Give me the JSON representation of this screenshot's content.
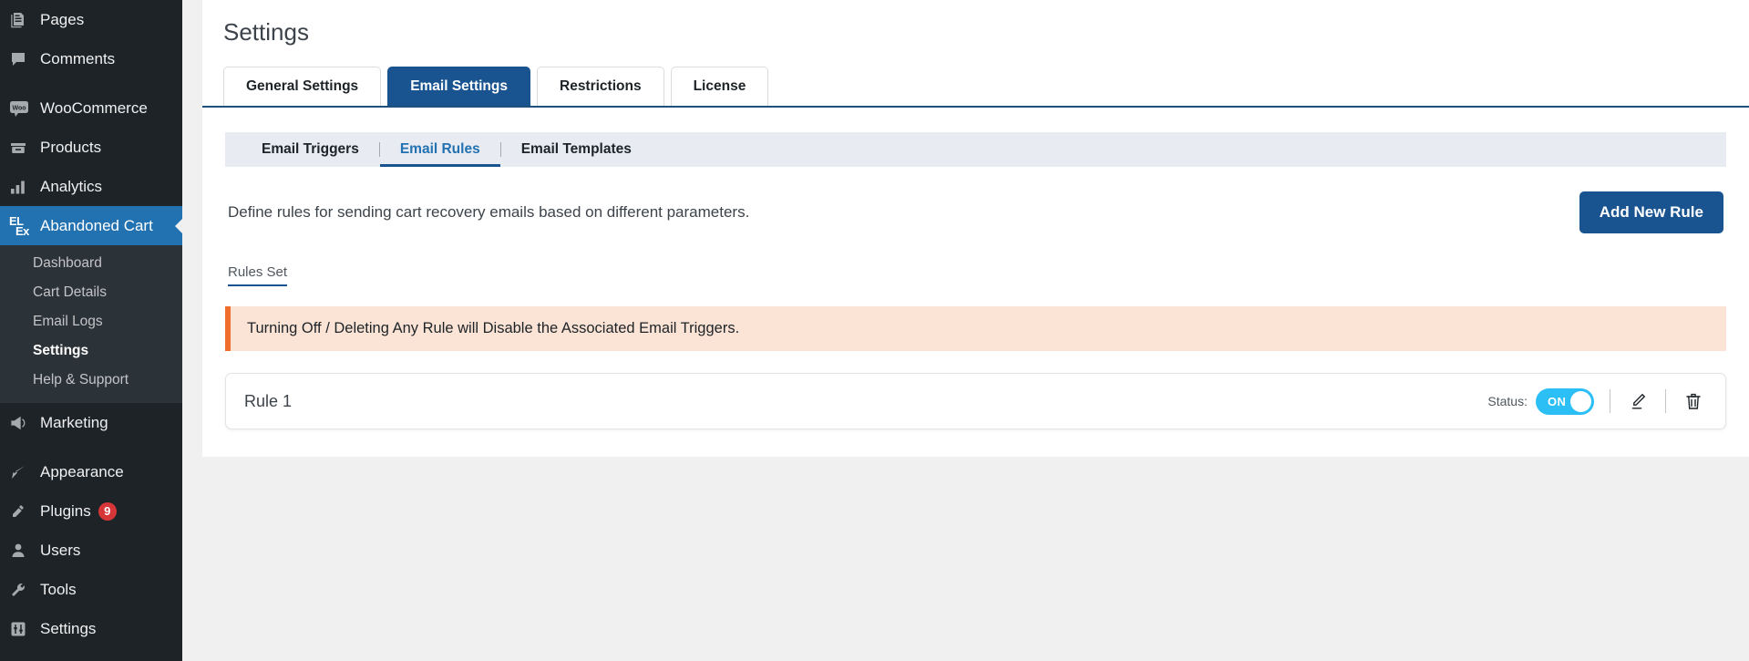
{
  "sidebar": {
    "items": [
      {
        "label": "Pages",
        "icon": "pages-icon",
        "active": false
      },
      {
        "label": "Comments",
        "icon": "comments-icon",
        "active": false
      },
      {
        "label": "WooCommerce",
        "icon": "woocommerce-icon",
        "active": false
      },
      {
        "label": "Products",
        "icon": "products-icon",
        "active": false
      },
      {
        "label": "Analytics",
        "icon": "analytics-icon",
        "active": false
      },
      {
        "label": "Abandoned Cart",
        "icon": "elex-icon",
        "active": true
      },
      {
        "label": "Marketing",
        "icon": "megaphone-icon",
        "active": false
      },
      {
        "label": "Appearance",
        "icon": "paintbrush-icon",
        "active": false
      },
      {
        "label": "Plugins",
        "icon": "plug-icon",
        "active": false,
        "badge": "9"
      },
      {
        "label": "Users",
        "icon": "user-icon",
        "active": false
      },
      {
        "label": "Tools",
        "icon": "wrench-icon",
        "active": false
      },
      {
        "label": "Settings",
        "icon": "settings-sliders-icon",
        "active": false
      }
    ],
    "submenu": [
      {
        "label": "Dashboard",
        "current": false
      },
      {
        "label": "Cart Details",
        "current": false
      },
      {
        "label": "Email Logs",
        "current": false
      },
      {
        "label": "Settings",
        "current": true
      },
      {
        "label": "Help & Support",
        "current": false
      }
    ],
    "elex_icon_top": "EL",
    "elex_icon_bottom": "Ex"
  },
  "page": {
    "title": "Settings"
  },
  "tabs": [
    {
      "label": "General Settings",
      "active": false
    },
    {
      "label": "Email Settings",
      "active": true
    },
    {
      "label": "Restrictions",
      "active": false
    },
    {
      "label": "License",
      "active": false
    }
  ],
  "subtabs": [
    {
      "label": "Email Triggers",
      "active": false
    },
    {
      "label": "Email Rules",
      "active": true
    },
    {
      "label": "Email Templates",
      "active": false
    }
  ],
  "main": {
    "description": "Define rules for sending cart recovery emails based on different parameters.",
    "add_rule_button": "Add New Rule",
    "rules_set_label": "Rules Set",
    "notice": "Turning Off / Deleting Any Rule will Disable the Associated Email Triggers.",
    "status_label": "Status:",
    "toggle_state": "ON"
  },
  "rules": [
    {
      "name": "Rule 1",
      "status": "ON"
    }
  ],
  "colors": {
    "accent_blue": "#1a5490",
    "sidebar_bg": "#1d2327",
    "sidebar_active": "#2271b1",
    "toggle_on": "#2bbff5",
    "notice_bg": "#fbe4d6",
    "notice_border": "#ef6c2a",
    "badge_red": "#d63638"
  }
}
